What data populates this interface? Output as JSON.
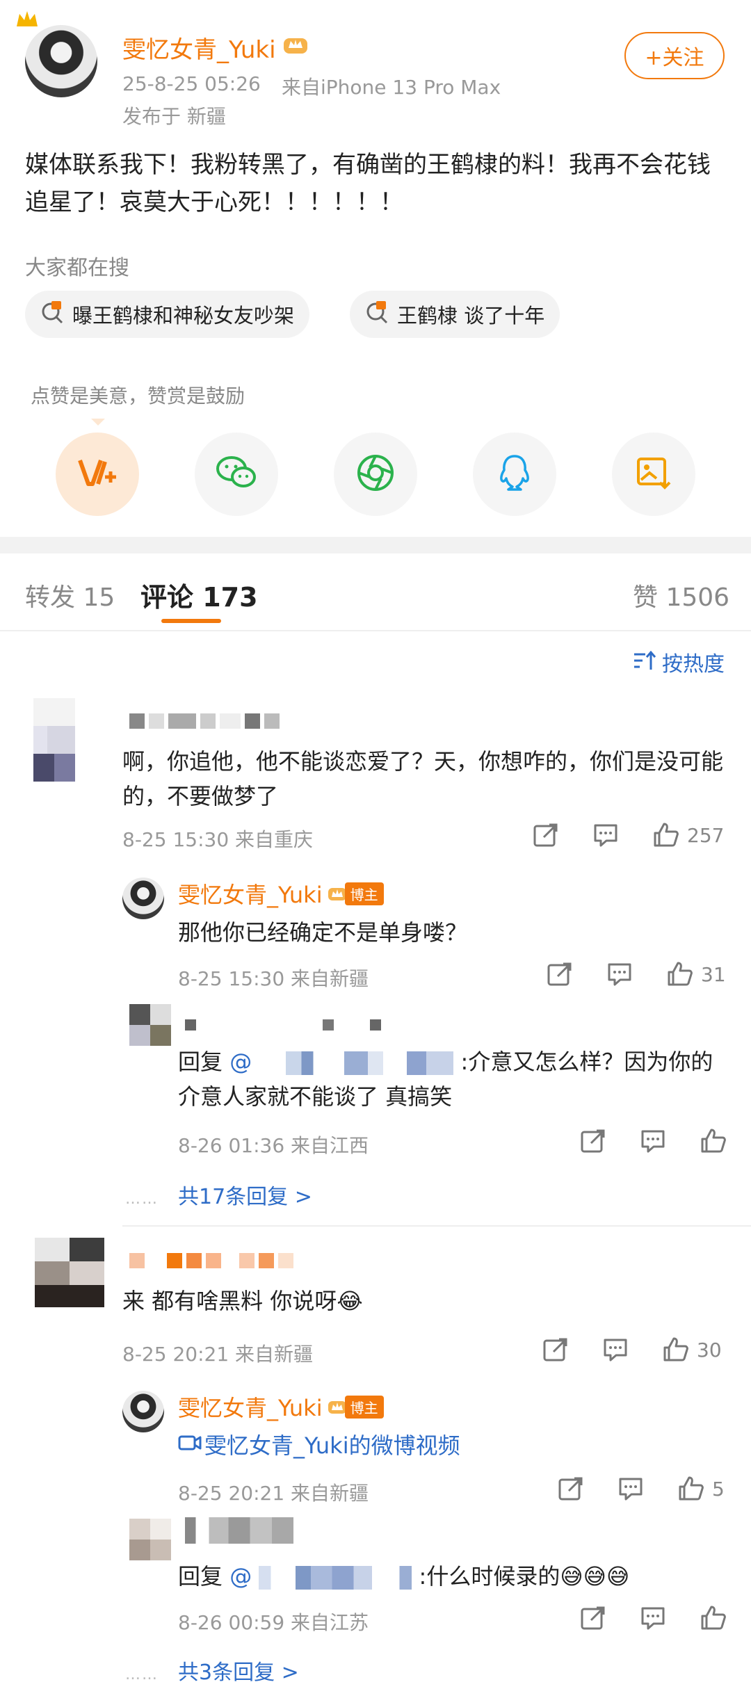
{
  "post": {
    "author": "雯忆女青_Yuki",
    "time": "25-8-25 05:26",
    "source": "来自iPhone 13 Pro Max",
    "location": "发布于 新疆",
    "follow_label": "+关注",
    "content": "媒体联系我下！我粉转黑了，有确凿的王鹤棣的料！我再不会花钱追星了！哀莫大于心死！！！！！！"
  },
  "search": {
    "title": "大家都在搜",
    "tags": [
      {
        "label": "曝王鹤棣和神秘女友吵架"
      },
      {
        "label": "王鹤棣 谈了十年"
      }
    ]
  },
  "reward": {
    "caption": "点赞是美意，赞赏是鼓励",
    "share_icons": [
      "vplus-icon",
      "wechat-icon",
      "moments-icon",
      "qq-icon",
      "save-image-icon"
    ]
  },
  "tabs": {
    "repost": "转发 15",
    "comments": "评论 173",
    "likes": "赞 1506",
    "sort_label": "按热度"
  },
  "comments": [
    {
      "text": "啊，你追他，他不能谈恋爱了？天，你想咋的，你们是没可能的，不要做梦了",
      "meta": "8-25 15:30  来自重庆",
      "likes": "257",
      "replies": [
        {
          "author": "雯忆女青_Yuki",
          "badge": "博主",
          "text": "那他你已经确定不是单身喽？",
          "meta": "8-25 15:30  来自新疆",
          "likes": "31"
        },
        {
          "prefix": "回复",
          "mention": "@",
          "text": ":介意又怎么样？因为你的介意人家就不能谈了 真搞笑",
          "meta": "8-26 01:36  来自江西",
          "likes": ""
        }
      ],
      "more": "共17条回复 >"
    },
    {
      "text": "来 都有啥黑料 你说呀😂",
      "meta": "8-25 20:21  来自新疆",
      "likes": "30",
      "replies": [
        {
          "author": "雯忆女青_Yuki",
          "badge": "博主",
          "text": "雯忆女青_Yuki的微博视频",
          "meta": "8-25 20:21  来自新疆",
          "likes": "5"
        },
        {
          "prefix": "回复",
          "mention": "@",
          "text": ":什么时候录的😅😅😅",
          "meta": "8-26 00:59  来自江苏",
          "likes": ""
        }
      ],
      "more": "共3条回复 >"
    }
  ],
  "colors": {
    "accent": "#f2790d",
    "link": "#2e6cc7",
    "meta": "#999999",
    "divider": "#eeeeee"
  }
}
